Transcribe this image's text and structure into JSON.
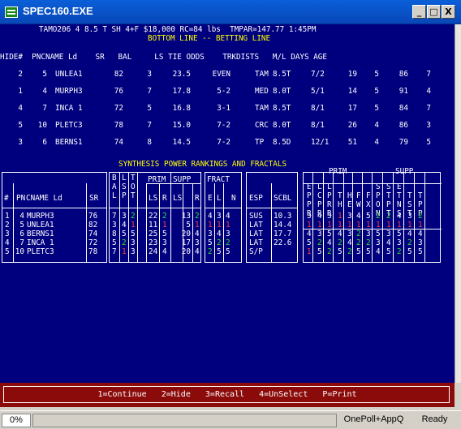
{
  "window": {
    "title": "SPEC160.EXE",
    "minimize_label": "_",
    "maximize_label": "□",
    "close_label": "X"
  },
  "header": {
    "line1": "TAMO206 4 8.5 T SH 4+F $18,000 RC=84 lbs  TMPAR=147.77 1:45PM",
    "line2": "BOTTOM LINE -- BETTING LINE"
  },
  "betting_table": {
    "columns": [
      "HIDE#",
      "PN",
      "CNAME",
      "Ld",
      "SR",
      "BAL",
      "LS",
      "TIE",
      "ODDS",
      "TRK",
      "DIST",
      "S",
      "M/L",
      "DAYS",
      "AGE",
      "",
      ""
    ],
    "header_text": "HIDE#  PNCNAME Ld    SR   BAL     LS TIE ODDS    TRKDISTS   M/L DAYS AGE",
    "rows": [
      {
        "hide": "2",
        "pn": "5",
        "name": "UNLEA1",
        "sr": "82",
        "bal": "3",
        "ls": "23.5",
        "odds": "EVEN",
        "trk": "TAM",
        "dist": "8.5T",
        "ml": "7/2",
        "days": "19",
        "age": "5",
        "c1": "86",
        "c2": "7"
      },
      {
        "hide": "1",
        "pn": "4",
        "name": "MURPH3",
        "sr": "76",
        "bal": "7",
        "ls": "17.8",
        "odds": "5-2",
        "trk": "MED",
        "dist": "8.0T",
        "ml": "5/1",
        "days": "14",
        "age": "5",
        "c1": "91",
        "c2": "4"
      },
      {
        "hide": "4",
        "pn": "7",
        "name": "INCA 1",
        "sr": "72",
        "bal": "5",
        "ls": "16.8",
        "odds": "3-1",
        "trk": "TAM",
        "dist": "8.5T",
        "ml": "8/1",
        "days": "17",
        "age": "5",
        "c1": "84",
        "c2": "7"
      },
      {
        "hide": "5",
        "pn": "10",
        "name": "PLETC3",
        "sr": "78",
        "bal": "7",
        "ls": "15.0",
        "odds": "7-2",
        "trk": "CRC",
        "dist": "8.0T",
        "ml": "8/1",
        "days": "26",
        "age": "4",
        "c1": "86",
        "c2": "3"
      },
      {
        "hide": "3",
        "pn": "6",
        "name": "BERNS1",
        "sr": "74",
        "bal": "8",
        "ls": "14.5",
        "odds": "7-2",
        "trk": "TP",
        "dist": "8.5D",
        "ml": "12/1",
        "days": "51",
        "age": "4",
        "c1": "79",
        "c2": "5"
      }
    ]
  },
  "synthesis": {
    "title": "SYNTHESIS POWER RANKINGS AND FRACTALS",
    "headers": {
      "num": "#",
      "pn": "PN",
      "name": "CNAME Ld",
      "sr": "SR",
      "bal": "BAL",
      "lsp": "LSP",
      "tot": "TOT",
      "prim": "PRIM",
      "supp": "SUPP",
      "ls1": "LS",
      "r1": "R",
      "ls2": "LS",
      "r2": "R",
      "fract": "FRACT",
      "e": "E",
      "l": "L",
      "n": "N",
      "esp": "ESP",
      "scbl": "SCBL",
      "prim2": "PRIM",
      "supp2": "SUPP",
      "right_cols": [
        "EPPR",
        "LCPR",
        "LPRR",
        "TH",
        "HE",
        "FW",
        "FX",
        "SPON",
        "STPT",
        "ETNS",
        "TST",
        "TPP"
      ]
    },
    "rows": [
      {
        "num": "1",
        "pn": "4",
        "name": "MURPH3",
        "sr": "76",
        "b": "7",
        "l": "3",
        "t": "2",
        "pls": "22",
        "pr": "2",
        "sls": "13",
        "sr2": "2",
        "e": "4",
        "lf": "3",
        "n": "4",
        "esp": "SUS",
        "scbl": "10.3",
        "r": [
          "3",
          "4",
          "3",
          "1",
          "3",
          "4",
          "5",
          "2",
          "2",
          "4",
          "3",
          "2"
        ]
      },
      {
        "num": "2",
        "pn": "5",
        "name": "UNLEA1",
        "sr": "82",
        "b": "3",
        "l": "4",
        "t": "1",
        "pls": "11",
        "pr": "1",
        "sls": "5",
        "sr2": "1",
        "e": "1",
        "lf": "1",
        "n": "1",
        "esp": "LAT",
        "scbl": "14.4",
        "r": [
          "1",
          "1",
          "1",
          "1",
          "1",
          "1",
          "1",
          "1",
          "1",
          "1",
          "1",
          "1"
        ]
      },
      {
        "num": "3",
        "pn": "6",
        "name": "BERNS1",
        "sr": "74",
        "b": "8",
        "l": "5",
        "t": "5",
        "pls": "25",
        "pr": "5",
        "sls": "20",
        "sr2": "4",
        "e": "3",
        "lf": "4",
        "n": "3",
        "esp": "LAT",
        "scbl": "17.7",
        "r": [
          "4",
          "3",
          "5",
          "4",
          "3",
          "2",
          "3",
          "5",
          "3",
          "5",
          "4",
          "4"
        ]
      },
      {
        "num": "4",
        "pn": "7",
        "name": "INCA 1",
        "sr": "72",
        "b": "5",
        "l": "2",
        "t": "3",
        "pls": "23",
        "pr": "3",
        "sls": "17",
        "sr2": "3",
        "e": "5",
        "lf": "2",
        "n": "2",
        "esp": "LAT",
        "scbl": "22.6",
        "r": [
          "5",
          "2",
          "4",
          "2",
          "4",
          "2",
          "2",
          "3",
          "4",
          "3",
          "2",
          "3"
        ]
      },
      {
        "num": "5",
        "pn": "10",
        "name": "PLETC3",
        "sr": "78",
        "b": "7",
        "l": "1",
        "t": "3",
        "pls": "24",
        "pr": "4",
        "sls": "20",
        "sr2": "4",
        "e": "2",
        "lf": "5",
        "n": "5",
        "esp": "S/P",
        "scbl": "",
        "r": [
          "1",
          "5",
          "2",
          "5",
          "2",
          "5",
          "5",
          "4",
          "5",
          "2",
          "5",
          "5"
        ]
      }
    ]
  },
  "function_keys": "1=Continue   2=Hide   3=Recall   4=UnSelect   P=Print",
  "status": {
    "progress_text": "0%",
    "progress_value": 0,
    "middle": "OnePoll+AppQ",
    "right": "Ready"
  },
  "colors": {
    "screen_bg": "#00007f",
    "highlight_yellow": "#ffff00",
    "rank_green": "#30e030",
    "rank_red": "#ff4040",
    "fkey_bar": "#8b0b0b"
  }
}
